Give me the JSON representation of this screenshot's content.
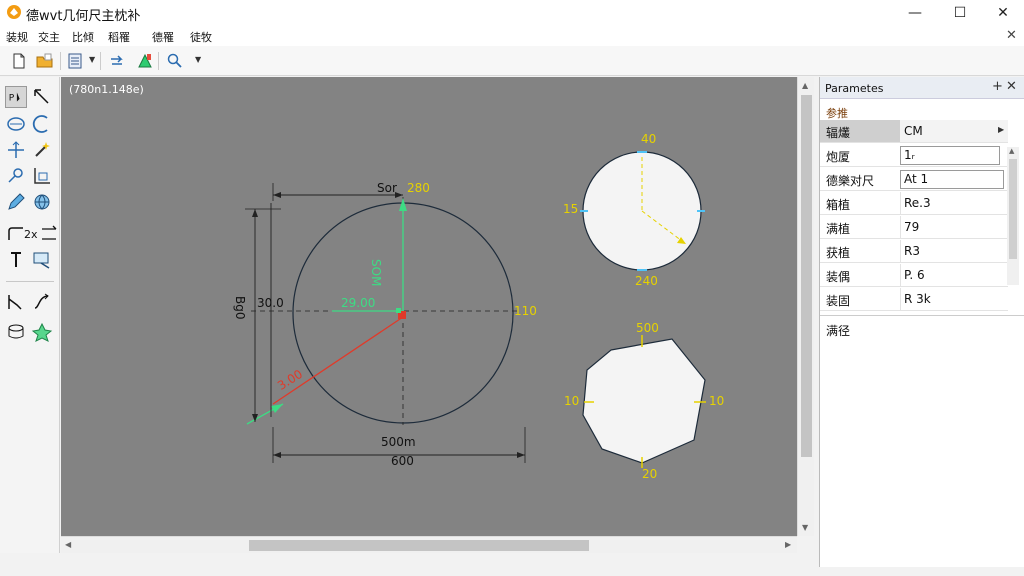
{
  "window": {
    "title": "德wvt几何尺主枕补",
    "controls": {
      "minimize": "—",
      "maximize": "☐",
      "close": "✕"
    }
  },
  "menu": {
    "items": [
      "装规",
      "交主",
      "比倾",
      "稻罹",
      "德罹",
      "徒牧"
    ],
    "close_symbol": "✕"
  },
  "toolbar": {
    "icons": [
      "new-file-icon",
      "open-folder-icon",
      "layers-icon",
      "redo-icon",
      "paint-icon",
      "zoom-icon"
    ]
  },
  "palette": {
    "label_2x": "2x"
  },
  "canvas": {
    "coord_readout": "(780n1.148e)",
    "big_circle": {
      "top_dim_text": "Sor",
      "top_dim_value": "280",
      "vertical_radius_label": "SOM",
      "center_label": "29.00",
      "right_label": "110",
      "left_dim_text": "Bg0",
      "left_dim_value": "30.0",
      "diag_label": "3.00",
      "bottom_dim_text": "500m",
      "bottom_dim_value": "600"
    },
    "small_circle": {
      "top": "40",
      "left": "15",
      "bottom": "240"
    },
    "octagon": {
      "top": "500",
      "left": "10",
      "right": "10",
      "bottom": "20"
    }
  },
  "panel": {
    "title": "Parametes",
    "pin_symbol": "+",
    "close_symbol": "✕",
    "section": "参推",
    "rows": [
      {
        "name": "辐爜",
        "value": "CM"
      },
      {
        "name": "炮厦",
        "value": "1ᵣ"
      },
      {
        "name": "德樂对尺",
        "value": "At 1"
      },
      {
        "name": "箱植",
        "value": "Re.3"
      },
      {
        "name": "满植",
        "value": "79"
      },
      {
        "name": "获植",
        "value": "R3"
      },
      {
        "name": "装偶",
        "value": "P. 6"
      },
      {
        "name": "装固",
        "value": "R 3k"
      }
    ],
    "description_label": "满径"
  },
  "colors": {
    "canvas_bg": "#838383",
    "dim_green": "#3ddc84",
    "dim_yellow": "#e6d200",
    "red_line": "#e03a2a"
  }
}
